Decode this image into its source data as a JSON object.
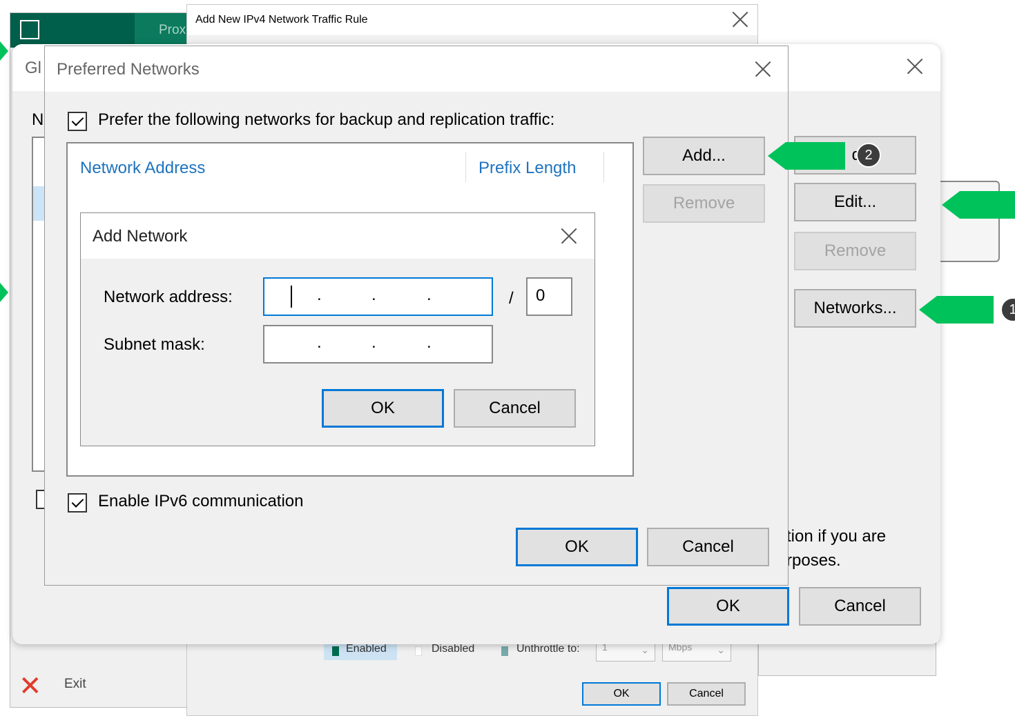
{
  "background_app": {
    "tab_text": "Prox",
    "exit_label": "Exit"
  },
  "traffic_rule_window": {
    "title": "Add New IPv4 Network Traffic Rule",
    "legend_enabled": "Enabled",
    "legend_disabled": "Disabled",
    "legend_unthrottle": "Unthrottle to:",
    "unthrottle_value": "1",
    "unit_value": "Mbps",
    "ok_label": "OK",
    "cancel_label": "Cancel"
  },
  "global_window": {
    "title_partial": "Gl",
    "list_label_partial": "N",
    "add_label_partial": "d",
    "edit_label": "Edit...",
    "remove_label": "Remove",
    "networks_label": "Networks...",
    "note_line1": "tion if you are",
    "note_line2": "rposes.",
    "ok_label": "OK",
    "cancel_label": "Cancel"
  },
  "preferred_networks": {
    "title": "Preferred Networks",
    "prefer_checkbox_label": "Prefer the following networks for backup and replication traffic:",
    "prefer_checked": true,
    "columns": [
      "Network Address",
      "Prefix Length"
    ],
    "add_label": "Add...",
    "remove_label": "Remove",
    "ipv6_checkbox_label": "Enable IPv6 communication",
    "ipv6_checked": true,
    "ok_label": "OK",
    "cancel_label": "Cancel"
  },
  "add_network": {
    "title": "Add Network",
    "address_label": "Network address:",
    "address_value": "   .   .   .",
    "prefix_separator": "/",
    "prefix_value": "0",
    "mask_label": "Subnet mask:",
    "mask_value": "   .   .   .",
    "ok_label": "OK",
    "cancel_label": "Cancel"
  },
  "annotations": {
    "badge_1": "1",
    "badge_2": "2",
    "accent_color": "#00c25a"
  }
}
